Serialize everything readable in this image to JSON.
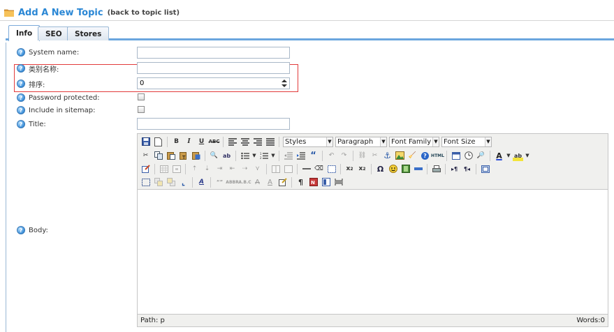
{
  "header": {
    "title": "Add A New Topic",
    "back_link": "(back to topic list)"
  },
  "tabs": [
    {
      "label": "Info",
      "active": true
    },
    {
      "label": "SEO",
      "active": false
    },
    {
      "label": "Stores",
      "active": false
    }
  ],
  "form": {
    "system_name": {
      "label": "System name:",
      "value": ""
    },
    "category_name": {
      "label": "类别名称:",
      "value": ""
    },
    "sort_order": {
      "label": "排序:",
      "value": "0"
    },
    "password_protected": {
      "label": "Password protected:",
      "checked": false
    },
    "include_in_sitemap": {
      "label": "Include in sitemap:",
      "checked": false
    },
    "title": {
      "label": "Title:",
      "value": ""
    },
    "body": {
      "label": "Body:"
    }
  },
  "editor": {
    "dropdowns": {
      "styles": "Styles",
      "format": "Paragraph",
      "font_family": "Font Family",
      "font_size": "Font Size"
    },
    "path_label": "Path: p",
    "word_count": "Words:0",
    "html_button": "HTML"
  },
  "colors": {
    "title": "#2a87d5",
    "highlight_box": "#e23b3b",
    "tab_border": "#6aa6de"
  }
}
